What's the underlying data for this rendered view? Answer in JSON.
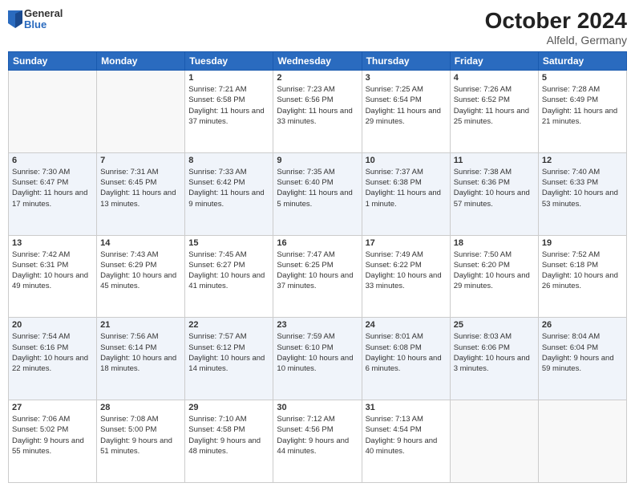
{
  "header": {
    "logo": {
      "general": "General",
      "blue": "Blue"
    },
    "title": "October 2024",
    "location": "Alfeld, Germany"
  },
  "days_of_week": [
    "Sunday",
    "Monday",
    "Tuesday",
    "Wednesday",
    "Thursday",
    "Friday",
    "Saturday"
  ],
  "weeks": [
    {
      "alt": false,
      "days": [
        {
          "num": "",
          "empty": true
        },
        {
          "num": "",
          "empty": true
        },
        {
          "num": "1",
          "sunrise": "7:21 AM",
          "sunset": "6:58 PM",
          "daylight": "11 hours and 37 minutes."
        },
        {
          "num": "2",
          "sunrise": "7:23 AM",
          "sunset": "6:56 PM",
          "daylight": "11 hours and 33 minutes."
        },
        {
          "num": "3",
          "sunrise": "7:25 AM",
          "sunset": "6:54 PM",
          "daylight": "11 hours and 29 minutes."
        },
        {
          "num": "4",
          "sunrise": "7:26 AM",
          "sunset": "6:52 PM",
          "daylight": "11 hours and 25 minutes."
        },
        {
          "num": "5",
          "sunrise": "7:28 AM",
          "sunset": "6:49 PM",
          "daylight": "11 hours and 21 minutes."
        }
      ]
    },
    {
      "alt": true,
      "days": [
        {
          "num": "6",
          "sunrise": "7:30 AM",
          "sunset": "6:47 PM",
          "daylight": "11 hours and 17 minutes."
        },
        {
          "num": "7",
          "sunrise": "7:31 AM",
          "sunset": "6:45 PM",
          "daylight": "11 hours and 13 minutes."
        },
        {
          "num": "8",
          "sunrise": "7:33 AM",
          "sunset": "6:42 PM",
          "daylight": "11 hours and 9 minutes."
        },
        {
          "num": "9",
          "sunrise": "7:35 AM",
          "sunset": "6:40 PM",
          "daylight": "11 hours and 5 minutes."
        },
        {
          "num": "10",
          "sunrise": "7:37 AM",
          "sunset": "6:38 PM",
          "daylight": "11 hours and 1 minute."
        },
        {
          "num": "11",
          "sunrise": "7:38 AM",
          "sunset": "6:36 PM",
          "daylight": "10 hours and 57 minutes."
        },
        {
          "num": "12",
          "sunrise": "7:40 AM",
          "sunset": "6:33 PM",
          "daylight": "10 hours and 53 minutes."
        }
      ]
    },
    {
      "alt": false,
      "days": [
        {
          "num": "13",
          "sunrise": "7:42 AM",
          "sunset": "6:31 PM",
          "daylight": "10 hours and 49 minutes."
        },
        {
          "num": "14",
          "sunrise": "7:43 AM",
          "sunset": "6:29 PM",
          "daylight": "10 hours and 45 minutes."
        },
        {
          "num": "15",
          "sunrise": "7:45 AM",
          "sunset": "6:27 PM",
          "daylight": "10 hours and 41 minutes."
        },
        {
          "num": "16",
          "sunrise": "7:47 AM",
          "sunset": "6:25 PM",
          "daylight": "10 hours and 37 minutes."
        },
        {
          "num": "17",
          "sunrise": "7:49 AM",
          "sunset": "6:22 PM",
          "daylight": "10 hours and 33 minutes."
        },
        {
          "num": "18",
          "sunrise": "7:50 AM",
          "sunset": "6:20 PM",
          "daylight": "10 hours and 29 minutes."
        },
        {
          "num": "19",
          "sunrise": "7:52 AM",
          "sunset": "6:18 PM",
          "daylight": "10 hours and 26 minutes."
        }
      ]
    },
    {
      "alt": true,
      "days": [
        {
          "num": "20",
          "sunrise": "7:54 AM",
          "sunset": "6:16 PM",
          "daylight": "10 hours and 22 minutes."
        },
        {
          "num": "21",
          "sunrise": "7:56 AM",
          "sunset": "6:14 PM",
          "daylight": "10 hours and 18 minutes."
        },
        {
          "num": "22",
          "sunrise": "7:57 AM",
          "sunset": "6:12 PM",
          "daylight": "10 hours and 14 minutes."
        },
        {
          "num": "23",
          "sunrise": "7:59 AM",
          "sunset": "6:10 PM",
          "daylight": "10 hours and 10 minutes."
        },
        {
          "num": "24",
          "sunrise": "8:01 AM",
          "sunset": "6:08 PM",
          "daylight": "10 hours and 6 minutes."
        },
        {
          "num": "25",
          "sunrise": "8:03 AM",
          "sunset": "6:06 PM",
          "daylight": "10 hours and 3 minutes."
        },
        {
          "num": "26",
          "sunrise": "8:04 AM",
          "sunset": "6:04 PM",
          "daylight": "9 hours and 59 minutes."
        }
      ]
    },
    {
      "alt": false,
      "days": [
        {
          "num": "27",
          "sunrise": "7:06 AM",
          "sunset": "5:02 PM",
          "daylight": "9 hours and 55 minutes."
        },
        {
          "num": "28",
          "sunrise": "7:08 AM",
          "sunset": "5:00 PM",
          "daylight": "9 hours and 51 minutes."
        },
        {
          "num": "29",
          "sunrise": "7:10 AM",
          "sunset": "4:58 PM",
          "daylight": "9 hours and 48 minutes."
        },
        {
          "num": "30",
          "sunrise": "7:12 AM",
          "sunset": "4:56 PM",
          "daylight": "9 hours and 44 minutes."
        },
        {
          "num": "31",
          "sunrise": "7:13 AM",
          "sunset": "4:54 PM",
          "daylight": "9 hours and 40 minutes."
        },
        {
          "num": "",
          "empty": true
        },
        {
          "num": "",
          "empty": true
        }
      ]
    }
  ]
}
